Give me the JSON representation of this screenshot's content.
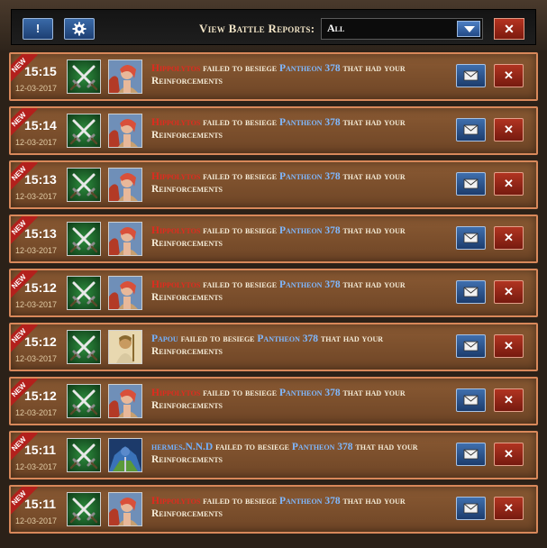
{
  "header": {
    "info_label": "!",
    "settings_icon": "gear-icon",
    "title": "View Battle Reports:",
    "filter_value": "All",
    "close_label": "✕"
  },
  "reports": [
    {
      "new_badge": "NEW",
      "time": "15:15",
      "date": "12-03-2017",
      "attacker": "Hippolytos",
      "attacker_style": "red",
      "avatar": "amazon",
      "text1": "failed to besiege",
      "target": "Pantheon 378",
      "text2": "that had your Reinforcements",
      "mail_icon": "envelope-icon",
      "delete_label": "✕"
    },
    {
      "new_badge": "NEW",
      "time": "15:14",
      "date": "12-03-2017",
      "attacker": "Hippolytos",
      "attacker_style": "red",
      "avatar": "amazon",
      "text1": "failed to besiege",
      "target": "Pantheon 378",
      "text2": "that had your Reinforcements",
      "mail_icon": "envelope-icon",
      "delete_label": "✕"
    },
    {
      "new_badge": "NEW",
      "time": "15:13",
      "date": "12-03-2017",
      "attacker": "Hippolytos",
      "attacker_style": "red",
      "avatar": "amazon",
      "text1": "failed to besiege",
      "target": "Pantheon 378",
      "text2": "that had your Reinforcements",
      "mail_icon": "envelope-icon",
      "delete_label": "✕"
    },
    {
      "new_badge": "NEW",
      "time": "15:13",
      "date": "12-03-2017",
      "attacker": "Hippolytos",
      "attacker_style": "red",
      "avatar": "amazon",
      "text1": "failed to besiege",
      "target": "Pantheon 378",
      "text2": "that had your Reinforcements",
      "mail_icon": "envelope-icon",
      "delete_label": "✕"
    },
    {
      "new_badge": "NEW",
      "time": "15:12",
      "date": "12-03-2017",
      "attacker": "Hippolytos",
      "attacker_style": "red",
      "avatar": "amazon",
      "text1": "failed to besiege",
      "target": "Pantheon 378",
      "text2": "that had your Reinforcements",
      "mail_icon": "envelope-icon",
      "delete_label": "✕"
    },
    {
      "new_badge": "NEW",
      "time": "15:12",
      "date": "12-03-2017",
      "attacker": "Papou",
      "attacker_style": "blue",
      "avatar": "priest",
      "text1": "failed to besiege",
      "target": "Pantheon 378",
      "text2": "that had your Reinforcements",
      "mail_icon": "envelope-icon",
      "delete_label": "✕"
    },
    {
      "new_badge": "NEW",
      "time": "15:12",
      "date": "12-03-2017",
      "attacker": "Hippolytos",
      "attacker_style": "red",
      "avatar": "amazon",
      "text1": "failed to besiege",
      "target": "Pantheon 378",
      "text2": "that had your Reinforcements",
      "mail_icon": "envelope-icon",
      "delete_label": "✕"
    },
    {
      "new_badge": "NEW",
      "time": "15:11",
      "date": "12-03-2017",
      "attacker": "hermes.N.N.D",
      "attacker_style": "blue",
      "avatar": "knight",
      "text1": "failed to besiege",
      "target": "Pantheon 378",
      "text2": "that had your Reinforcements",
      "mail_icon": "envelope-icon",
      "delete_label": "✕"
    },
    {
      "new_badge": "NEW",
      "time": "15:11",
      "date": "12-03-2017",
      "attacker": "Hippolytos",
      "attacker_style": "red",
      "avatar": "amazon",
      "text1": "failed to besiege",
      "target": "Pantheon 378",
      "text2": "that had your Reinforcements",
      "mail_icon": "envelope-icon",
      "delete_label": "✕"
    }
  ]
}
